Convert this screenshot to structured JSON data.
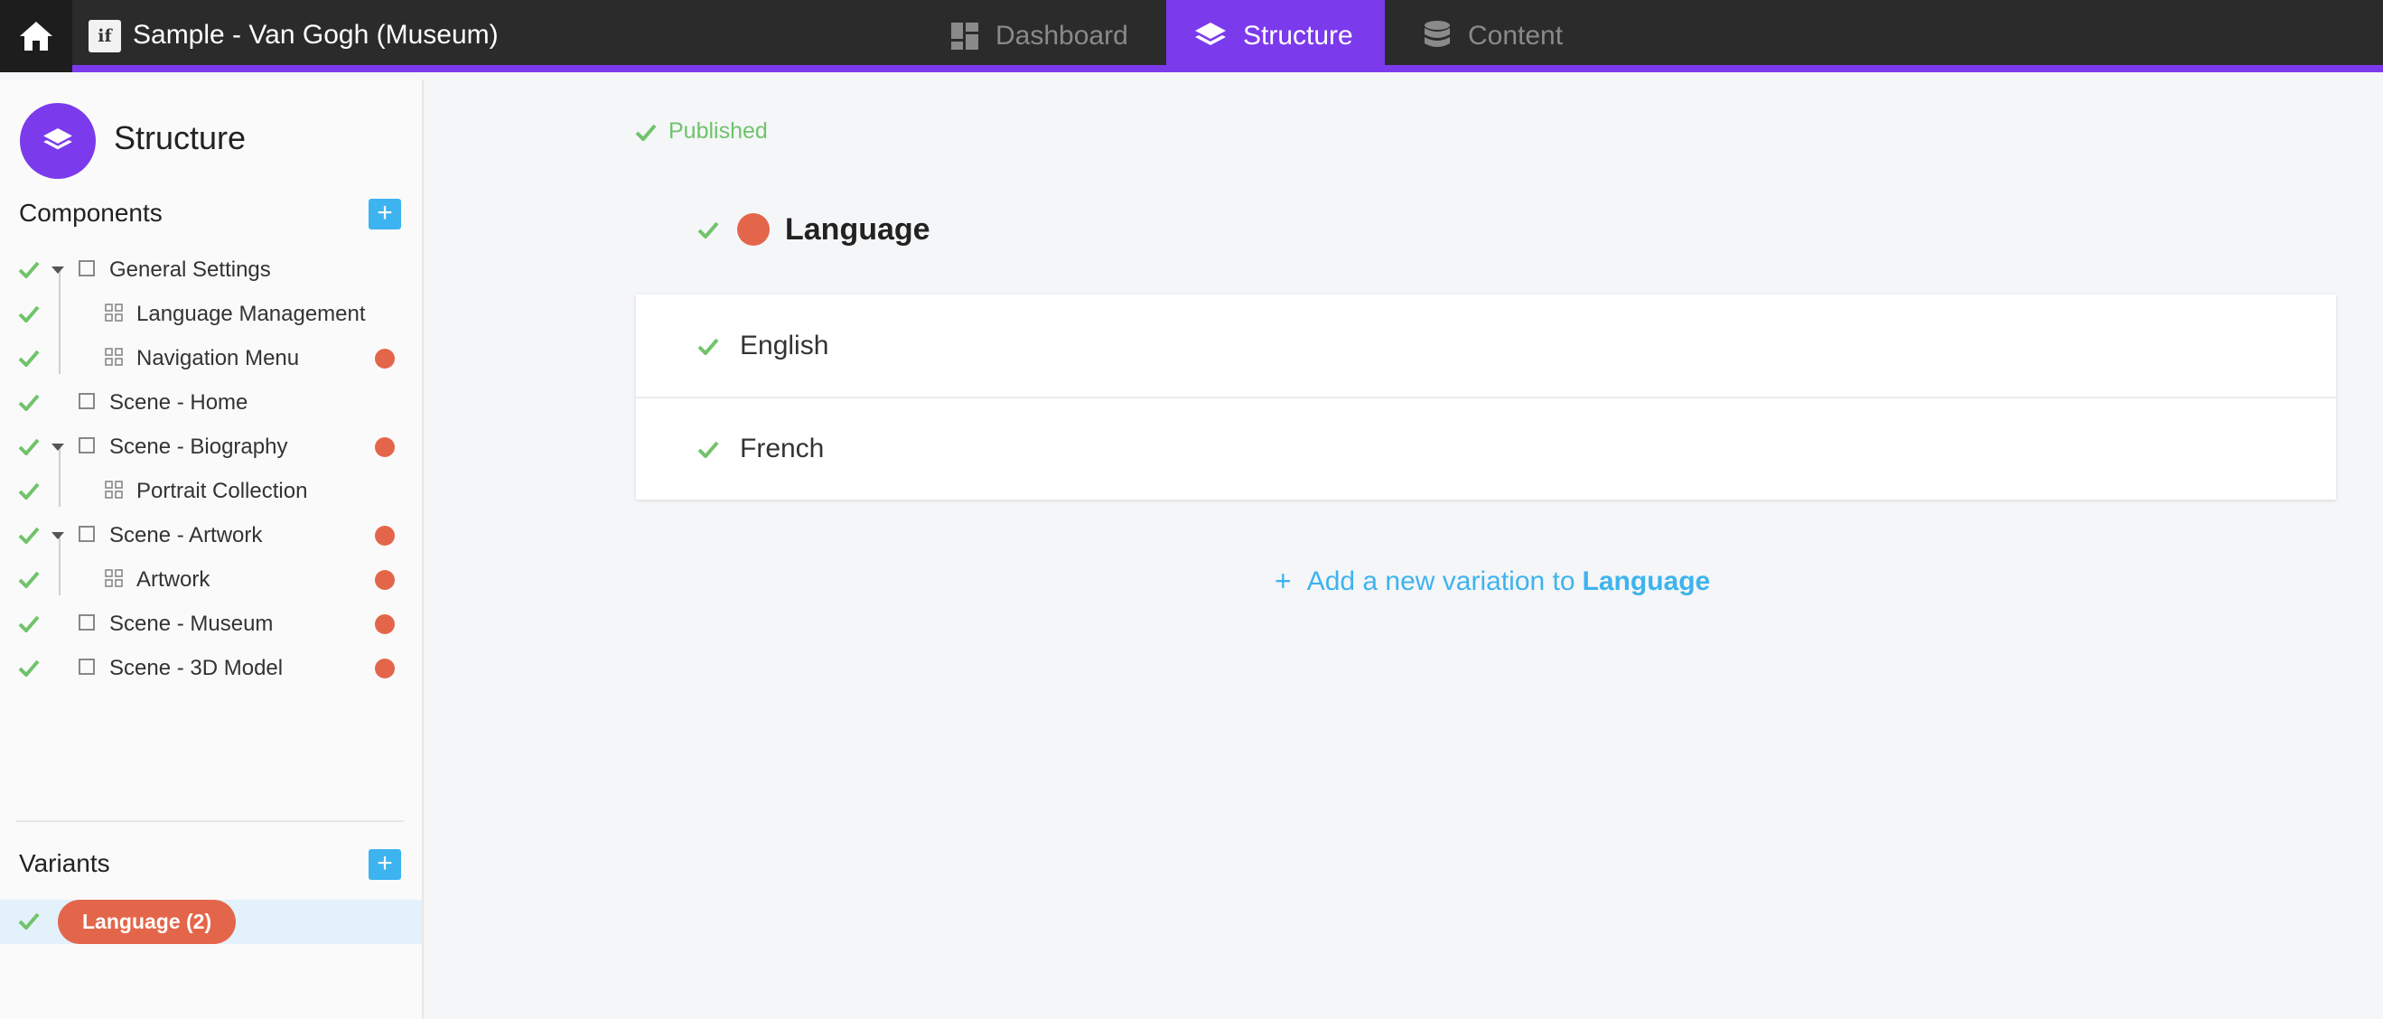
{
  "header": {
    "app_logo_text": "if",
    "app_title": "Sample - Van Gogh (Museum)",
    "tabs": [
      {
        "label": "Dashboard",
        "icon": "dashboard-icon",
        "active": false
      },
      {
        "label": "Structure",
        "icon": "layers-icon",
        "active": true
      },
      {
        "label": "Content",
        "icon": "database-icon",
        "active": false
      }
    ]
  },
  "sidebar": {
    "title": "Structure",
    "components_label": "Components",
    "add_symbol": "+",
    "components": [
      {
        "label": "General Settings",
        "type": "scene",
        "expanded": true,
        "level": 0,
        "published": true,
        "unsaved": false
      },
      {
        "label": "Language Management",
        "type": "component",
        "level": 1,
        "published": true,
        "unsaved": false
      },
      {
        "label": "Navigation Menu",
        "type": "component",
        "level": 1,
        "published": true,
        "unsaved": true
      },
      {
        "label": "Scene - Home",
        "type": "scene",
        "level": 0,
        "published": true,
        "unsaved": false
      },
      {
        "label": "Scene - Biography",
        "type": "scene",
        "expanded": true,
        "level": 0,
        "published": true,
        "unsaved": true
      },
      {
        "label": "Portrait Collection",
        "type": "component",
        "level": 1,
        "published": true,
        "unsaved": false
      },
      {
        "label": "Scene - Artwork",
        "type": "scene",
        "expanded": true,
        "level": 0,
        "published": true,
        "unsaved": true
      },
      {
        "label": "Artwork",
        "type": "component",
        "level": 1,
        "published": true,
        "unsaved": true
      },
      {
        "label": "Scene - Museum",
        "type": "scene",
        "level": 0,
        "published": true,
        "unsaved": true
      },
      {
        "label": "Scene - 3D Model",
        "type": "scene",
        "level": 0,
        "published": true,
        "unsaved": true
      }
    ],
    "variants_label": "Variants",
    "variants": [
      {
        "label": "Language (2)",
        "published": true,
        "selected": true
      }
    ]
  },
  "main": {
    "status": "Published",
    "component_name": "Language",
    "variations": [
      {
        "label": "English",
        "published": true
      },
      {
        "label": "French",
        "published": true
      }
    ],
    "add_variation": {
      "symbol": "+",
      "prefix": "Add a new variation to",
      "target": "Language"
    }
  },
  "colors": {
    "accent": "#7c3aed",
    "topbar": "#2b2b2b",
    "check": "#70c36b",
    "unsaved_dot": "#e4664a",
    "add_button": "#3db3ef",
    "selected_row": "#e3f1fb"
  }
}
